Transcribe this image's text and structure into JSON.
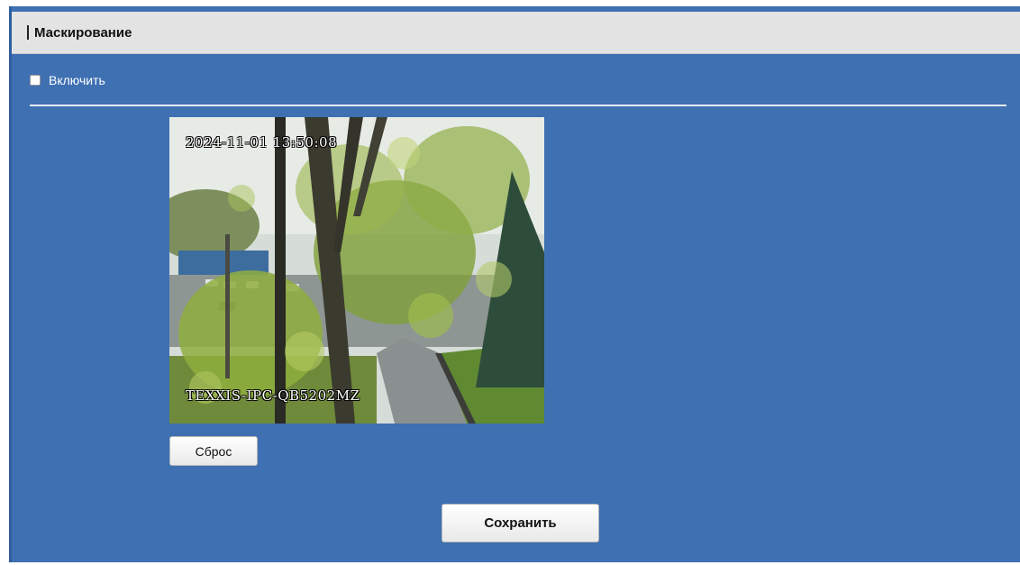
{
  "section": {
    "title": "Маскирование"
  },
  "enable": {
    "label": "Включить",
    "checked": false
  },
  "preview": {
    "timestamp": "2024-11-01 13:50:08",
    "camera_name": "TEXXIS-IPC-QB5202MZ"
  },
  "buttons": {
    "reset_label": "Сброс",
    "save_label": "Сохранить"
  },
  "colors": {
    "panel_background": "#3e70b2",
    "header_background": "#e3e3e3"
  }
}
